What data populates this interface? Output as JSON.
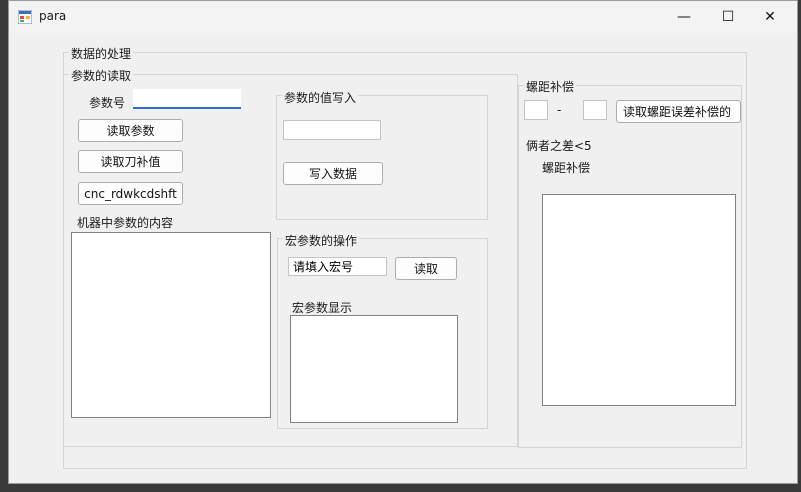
{
  "window": {
    "title": "para",
    "icon": "app-form-icon"
  },
  "titlebar_buttons": {
    "minimize": "—",
    "maximize": "☐",
    "close": "✕"
  },
  "groups": {
    "data_processing": "数据的处理",
    "param_read": "参数的读取",
    "param_write": "参数的值写入",
    "macro_ops": "宏参数的操作",
    "pitch_comp": "螺距补偿"
  },
  "param_read": {
    "param_no_label": "参数号",
    "param_no_value": "",
    "read_param_button": "读取参数",
    "read_tool_comp_button": "读取刀补值",
    "rdwkcdshft_button": "cnc_rdwkcdshft",
    "machine_content_label": "机器中参数的内容"
  },
  "param_write": {
    "value_input": "",
    "write_button": "写入数据"
  },
  "macro": {
    "macro_input_value": "请填入宏号",
    "read_button": "读取",
    "display_label": "宏参数显示"
  },
  "pitch": {
    "from_value": "",
    "dash": "-",
    "to_value": "",
    "read_error_button": "读取螺距误差补偿的",
    "diff_label": "俩者之差<5",
    "comp_label": "螺距补偿"
  }
}
